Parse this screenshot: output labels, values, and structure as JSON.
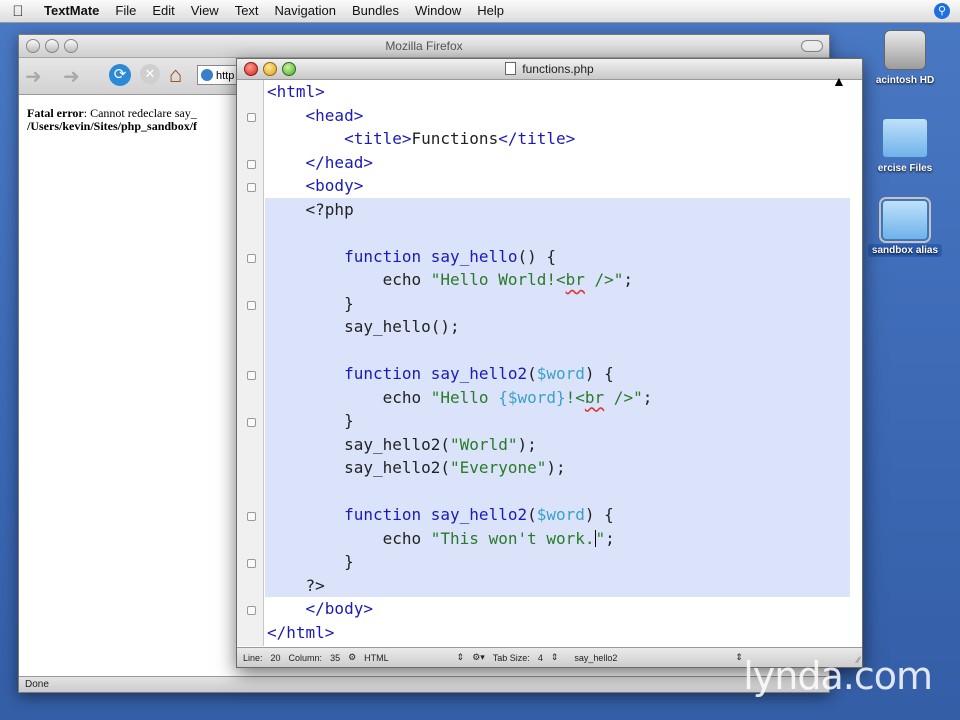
{
  "menubar": {
    "app": "TextMate",
    "items": [
      "File",
      "Edit",
      "View",
      "Text",
      "Navigation",
      "Bundles",
      "Window",
      "Help"
    ]
  },
  "desktop": {
    "icons": [
      {
        "label": "acintosh HD",
        "kind": "hard-drive"
      },
      {
        "label": "ercise Files",
        "kind": "folder"
      },
      {
        "label": "sandbox alias",
        "kind": "folder-alias",
        "selected": true
      }
    ]
  },
  "firefox": {
    "title": "Mozilla Firefox",
    "url_partial": "http",
    "error_label": "Fatal error",
    "error_text": ": Cannot redeclare say_",
    "error_path": "/Users/kevin/Sites/php_sandbox/f",
    "status": "Done"
  },
  "textmate": {
    "title": "functions.php",
    "code_lines": [
      {
        "text": "<html>",
        "indent": 0,
        "type": "tag",
        "fold": false
      },
      {
        "text": "<head>",
        "indent": 1,
        "type": "tag",
        "fold": true
      },
      {
        "text": "<title>Functions</title>",
        "indent": 2,
        "type": "title",
        "fold": false
      },
      {
        "text": "</head>",
        "indent": 1,
        "type": "tag",
        "fold": true
      },
      {
        "text": "<body>",
        "indent": 1,
        "type": "tag",
        "fold": true
      },
      {
        "text": "<?php",
        "indent": 1,
        "type": "php",
        "fold": false
      },
      {
        "text": "",
        "indent": 0,
        "type": "blank",
        "fold": false
      },
      {
        "text": "function say_hello() {",
        "indent": 2,
        "type": "fn",
        "fn": "say_hello",
        "args": "()",
        "fold": true
      },
      {
        "text": "echo \"Hello World!<br />\";",
        "indent": 3,
        "type": "echo",
        "str": "\"Hello World!<br />\"",
        "fold": false
      },
      {
        "text": "}",
        "indent": 2,
        "type": "plain",
        "fold": true
      },
      {
        "text": "say_hello();",
        "indent": 2,
        "type": "plain",
        "fold": false
      },
      {
        "text": "",
        "indent": 0,
        "type": "blank",
        "fold": false
      },
      {
        "text": "function say_hello2($word) {",
        "indent": 2,
        "type": "fn",
        "fn": "say_hello2",
        "fold": true
      },
      {
        "text": "echo \"Hello {$word}!<br />\";",
        "indent": 3,
        "type": "echo2",
        "fold": false
      },
      {
        "text": "}",
        "indent": 2,
        "type": "plain",
        "fold": true
      },
      {
        "text": "say_hello2(\"World\");",
        "indent": 2,
        "type": "call",
        "fn": "say_hello2",
        "str": "\"World\"",
        "fold": false
      },
      {
        "text": "say_hello2(\"Everyone\");",
        "indent": 2,
        "type": "call",
        "fn": "say_hello2",
        "str": "\"Everyone\"",
        "fold": false
      },
      {
        "text": "",
        "indent": 0,
        "type": "blank",
        "fold": false
      },
      {
        "text": "function say_hello2($word) {",
        "indent": 2,
        "type": "fn",
        "fn": "say_hello2",
        "fold": true
      },
      {
        "text": "echo \"This won't work.\";",
        "indent": 3,
        "type": "echo3",
        "fold": false
      },
      {
        "text": "}",
        "indent": 2,
        "type": "plain",
        "fold": true
      },
      {
        "text": "?>",
        "indent": 1,
        "type": "plain",
        "fold": false
      },
      {
        "text": "</body>",
        "indent": 1,
        "type": "tag",
        "fold": true
      },
      {
        "text": "</html>",
        "indent": 0,
        "type": "tag",
        "fold": false
      }
    ],
    "highlight_range": [
      5,
      21
    ],
    "status": {
      "line_label": "Line:",
      "line": "20",
      "column_label": "Column:",
      "column": "35",
      "language": "HTML",
      "tab_label": "Tab Size:",
      "tab_size": "4",
      "symbol": "say_hello2"
    }
  },
  "watermark": "lynda.com"
}
